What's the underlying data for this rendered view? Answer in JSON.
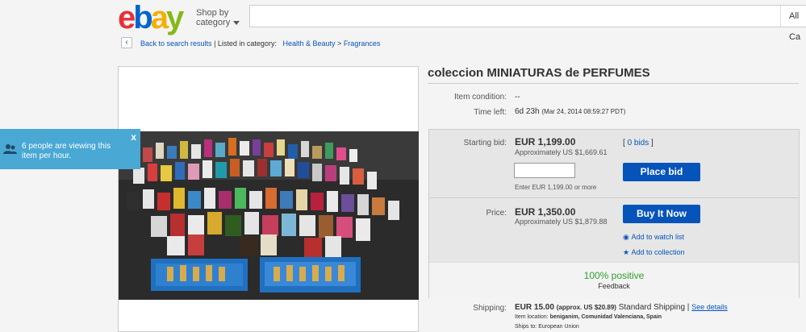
{
  "header": {
    "logo_letters": [
      "e",
      "b",
      "a",
      "y"
    ],
    "logo_colors": [
      "#e53238",
      "#0064d2",
      "#f5af02",
      "#86b817"
    ],
    "shop_by": "Shop by",
    "category": "category",
    "search_placeholder": "",
    "category_select": "All Ca"
  },
  "breadcrumb": {
    "back_icon": "chevron-left-icon",
    "back_label": "Back to search results",
    "listed_in": "| Listed in category:",
    "cat1": "Health & Beauty",
    "sep": ">",
    "cat2": "Fragrances"
  },
  "viewers": {
    "text": "6 people are viewing this item per hour.",
    "close": "x",
    "icon": "people-icon"
  },
  "item": {
    "title": "coleccion MINIATURAS de PERFUMES",
    "condition_label": "Item condition:",
    "condition_value": "--",
    "time_left_label": "Time left:",
    "time_left_value": "6d 23h",
    "time_left_date": "(Mar 24, 2014   08:59:27 PDT)"
  },
  "bid": {
    "starting_label": "Starting bid:",
    "starting_price": "EUR 1,199.00",
    "starting_approx": "Approximately US $1,669.61",
    "bids_open": "[",
    "bids_link": "0 bids",
    "bids_close": "]",
    "input_value": "",
    "enter_hint": "Enter EUR 1,199.00 or more",
    "place_bid": "Place bid"
  },
  "buy": {
    "price_label": "Price:",
    "price": "EUR 1,350.00",
    "approx": "Approximately US $1,879.88",
    "buy_now": "Buy It Now",
    "watch": "Add to watch list",
    "collection": "Add to collection"
  },
  "seller": {
    "positive": "100% positive",
    "feedback": "Feedback"
  },
  "shipping": {
    "label": "Shipping:",
    "price": "EUR 15.00",
    "approx": "(approx. US $20.89)",
    "method": "Standard Shipping |",
    "details": "See details",
    "location_label": "Item location:",
    "location_value": "beniganim, Comunidad Valenciana, Spain",
    "ships_to_label": "Ships to:",
    "ships_to_value": "European Union"
  }
}
